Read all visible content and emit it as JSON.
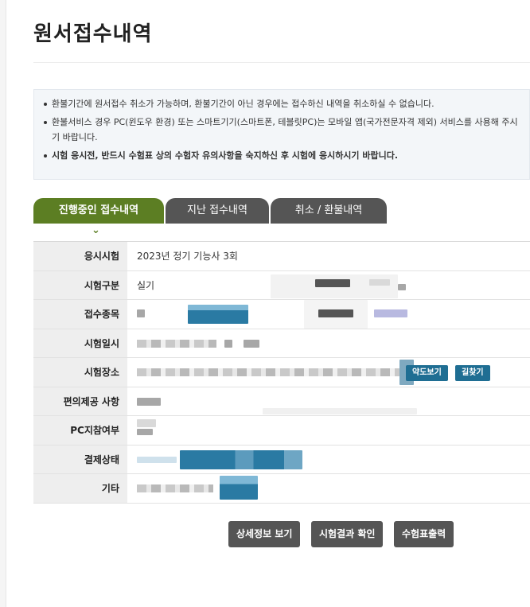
{
  "page_title": "원서접수내역",
  "notices": [
    {
      "text": "환불기간에 원서접수 취소가 가능하며, 환불기간이 아닌 경우에는 접수하신 내역을 취소하실 수 없습니다.",
      "bold": false
    },
    {
      "text": "환불서비스 경우 PC(윈도우 환경) 또는 스마트기기(스마트폰, 테블릿PC)는 모바일 앱(국가전문자격 제외) 서비스를 사용해 주시기 바랍니다.",
      "bold": false
    },
    {
      "text": "시험 응시전, 반드시 수험표 상의 수험자 유의사항을 숙지하신 후 시험에 응시하시기 바랍니다.",
      "bold": true
    }
  ],
  "tabs": [
    {
      "label": "진행중인 접수내역",
      "active": true
    },
    {
      "label": "지난 접수내역",
      "active": false
    },
    {
      "label": "취소 / 환불내역",
      "active": false
    }
  ],
  "rows": [
    {
      "label": "응시시험",
      "value": "2023년 정기 기능사 3회"
    },
    {
      "label": "시험구분",
      "value": "실기"
    },
    {
      "label": "접수종목",
      "value": ""
    },
    {
      "label": "시험일시",
      "value": ""
    },
    {
      "label": "시험장소",
      "value": ""
    },
    {
      "label": "편의제공 사항",
      "value": ""
    },
    {
      "label": "PC지참여부",
      "value": ""
    },
    {
      "label": "결제상태",
      "value": ""
    },
    {
      "label": "기타",
      "value": ""
    }
  ],
  "venue_buttons": {
    "map": "약도보기",
    "directions": "길찾기"
  },
  "actions": {
    "detail": "상세정보 보기",
    "result": "시험결과 확인",
    "print": "수험표출력"
  },
  "colors": {
    "active_tab": "#5c7e23",
    "inactive_tab": "#555555",
    "action_button": "#555555",
    "link_button": "#1f6e93"
  }
}
